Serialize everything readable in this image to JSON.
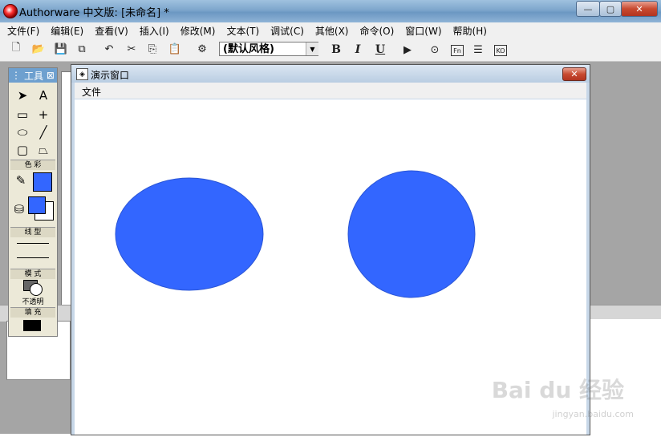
{
  "window": {
    "title": "Authorware 中文版: [未命名] *"
  },
  "menu": [
    "文件(F)",
    "编辑(E)",
    "查看(V)",
    "插入(I)",
    "修改(M)",
    "文本(T)",
    "调试(C)",
    "其他(X)",
    "命令(O)",
    "窗口(W)",
    "帮助(H)"
  ],
  "toolbar": {
    "style_value": "(默认风格)",
    "bold": "B",
    "italic": "I",
    "underline": "U",
    "fn_label": "Fn",
    "ko_label": "KO"
  },
  "tools_palette": {
    "title": "工具",
    "color_section": "色 彩",
    "line_section": "线 型",
    "mode_section": "模 式",
    "mode_value": "不透明",
    "fill_section": "填 充"
  },
  "presentation": {
    "title": "演示窗口",
    "menu_file": "文件",
    "ellipse_color": "#3366ff"
  },
  "watermark": {
    "text": "Bai du 经验",
    "url": "jingyan.baidu.com"
  }
}
